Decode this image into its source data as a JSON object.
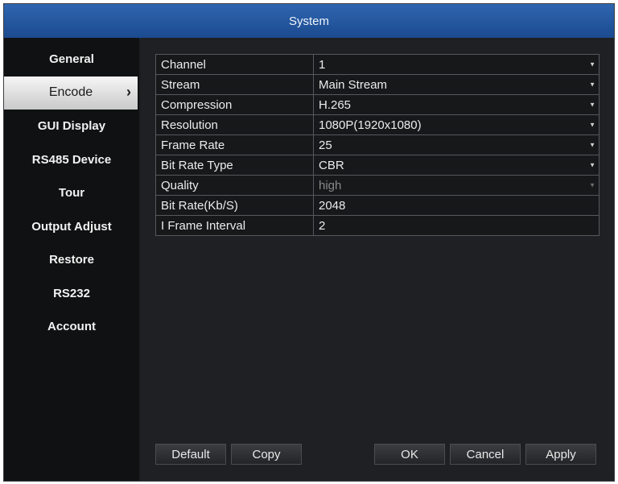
{
  "window": {
    "title": "System"
  },
  "sidebar": {
    "items": [
      {
        "label": "General"
      },
      {
        "label": "Encode",
        "active": true
      },
      {
        "label": "GUI Display"
      },
      {
        "label": "RS485 Device"
      },
      {
        "label": "Tour"
      },
      {
        "label": "Output Adjust"
      },
      {
        "label": "Restore"
      },
      {
        "label": "RS232"
      },
      {
        "label": "Account"
      }
    ]
  },
  "settings": [
    {
      "label": "Channel",
      "value": "1",
      "dropdown": true
    },
    {
      "label": "Stream",
      "value": "Main Stream",
      "dropdown": true
    },
    {
      "label": "Compression",
      "value": "H.265",
      "dropdown": true
    },
    {
      "label": "Resolution",
      "value": "1080P(1920x1080)",
      "dropdown": true
    },
    {
      "label": "Frame Rate",
      "value": "25",
      "dropdown": true
    },
    {
      "label": "Bit Rate Type",
      "value": "CBR",
      "dropdown": true
    },
    {
      "label": "Quality",
      "value": "high",
      "dropdown": true,
      "disabled": true
    },
    {
      "label": "Bit Rate(Kb/S)",
      "value": "2048",
      "dropdown": false
    },
    {
      "label": "I Frame Interval",
      "value": "2",
      "dropdown": false
    }
  ],
  "buttons": {
    "default": "Default",
    "copy": "Copy",
    "ok": "OK",
    "cancel": "Cancel",
    "apply": "Apply"
  },
  "icons": {
    "dropdown_arrow": "▼",
    "active_chevron": "›"
  }
}
